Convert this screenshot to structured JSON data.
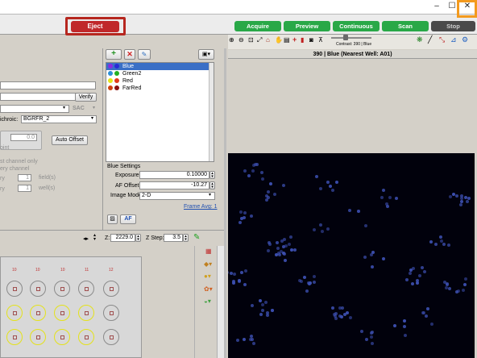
{
  "toolbar": {
    "eject": "Eject",
    "acquire": "Acquire",
    "preview": "Preview",
    "continuous": "Continuous",
    "scan": "Scan",
    "stop": "Stop"
  },
  "window": {
    "minimize": "–",
    "maximize": "☐",
    "close": "✕"
  },
  "left": {
    "verify": "Verify",
    "sac": "SAC",
    "dichroic_label": "ichroic:",
    "dichroic_value": "BGRFR_2",
    "offset_value": "0.0",
    "offset_note": "oint",
    "auto_offset": "Auto Offset",
    "scan_opt1": "st channel only",
    "scan_opt2": "ery channel",
    "field_count": "1",
    "field_unit": "field(s)",
    "field_label": "ry",
    "well_count": "1",
    "well_unit": "well(s)",
    "well_label": "ry"
  },
  "channels": {
    "items": [
      {
        "label": "Blue",
        "c1": "#8a2be2",
        "c2": "#2b2bd6"
      },
      {
        "label": "Green2",
        "c1": "#2b8fd6",
        "c2": "#22b022"
      },
      {
        "label": "Red",
        "c1": "#e6e61a",
        "c2": "#e23a1a"
      },
      {
        "label": "FarRed",
        "c1": "#d04010",
        "c2": "#8a1010"
      }
    ]
  },
  "settings": {
    "title": "Blue Settings",
    "exposure_label": "Exposure:",
    "exposure_value": "0.10000",
    "af_offset_label": "AF Offset:",
    "af_offset_value": "-10.27",
    "image_mode_label": "Image Mode:",
    "image_mode_value": "2-D",
    "frame_avg": "Frame Avg: 1",
    "af_button": "AF"
  },
  "stage": {
    "z_label": "Z:",
    "z_value": "2229.0",
    "zstep_label": "Z Step:",
    "zstep_value": "3.5"
  },
  "plate": {
    "columns": [
      "10",
      "10",
      "10",
      "11",
      "12"
    ]
  },
  "image": {
    "contrast": "Contrast: 390 | Blue",
    "title": "390 | Blue (Nearest Well: A01)"
  }
}
